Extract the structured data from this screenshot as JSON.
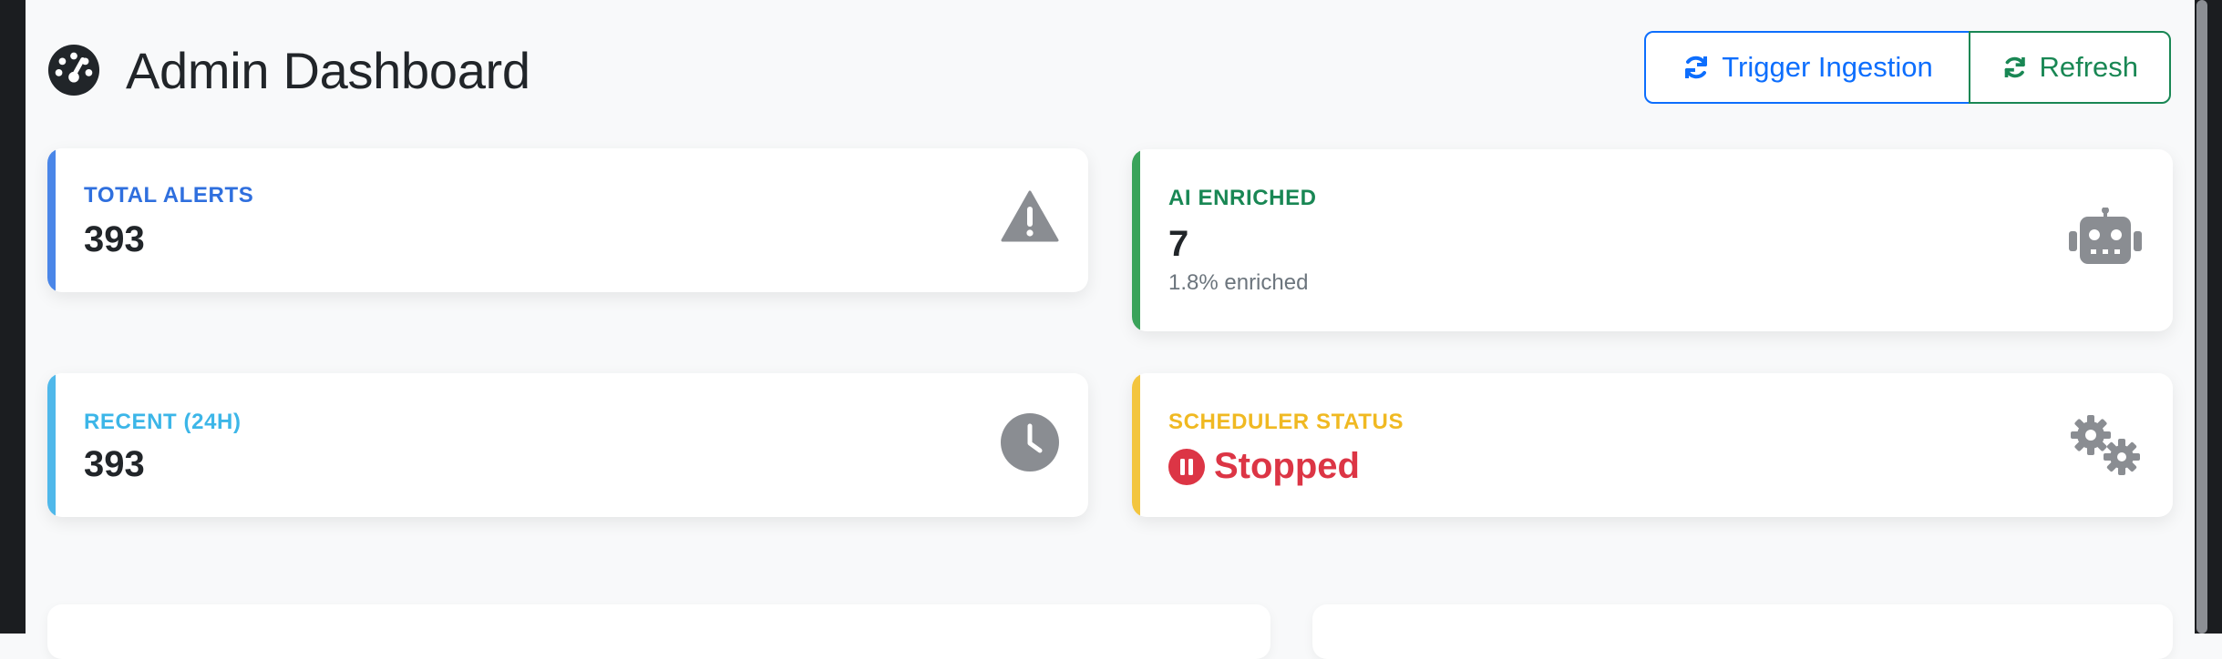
{
  "header": {
    "title": "Admin Dashboard",
    "icon": "tachometer-icon"
  },
  "actions": {
    "trigger_label": "Trigger Ingestion",
    "refresh_label": "Refresh",
    "trigger_color": "#0d6efd",
    "refresh_color": "#198754"
  },
  "cards": {
    "total_alerts": {
      "label": "TOTAL ALERTS",
      "value": "393",
      "color": "#0d6efd",
      "icon": "warning-triangle-icon"
    },
    "ai_enriched": {
      "label": "AI ENRICHED",
      "value": "7",
      "sub": "1.8% enriched",
      "color": "#198754",
      "icon": "robot-icon"
    },
    "recent": {
      "label": "RECENT (24H)",
      "value": "393",
      "color": "#0dcaf0",
      "icon": "clock-icon"
    },
    "scheduler": {
      "label": "SCHEDULER STATUS",
      "value": "Stopped",
      "status_color": "#dc3545",
      "color": "#ffc107",
      "icon": "gears-icon",
      "status_icon": "pause-circle-icon"
    }
  },
  "colors": {
    "icon_gray": "#8a8d92",
    "background": "#f8f9fa"
  }
}
